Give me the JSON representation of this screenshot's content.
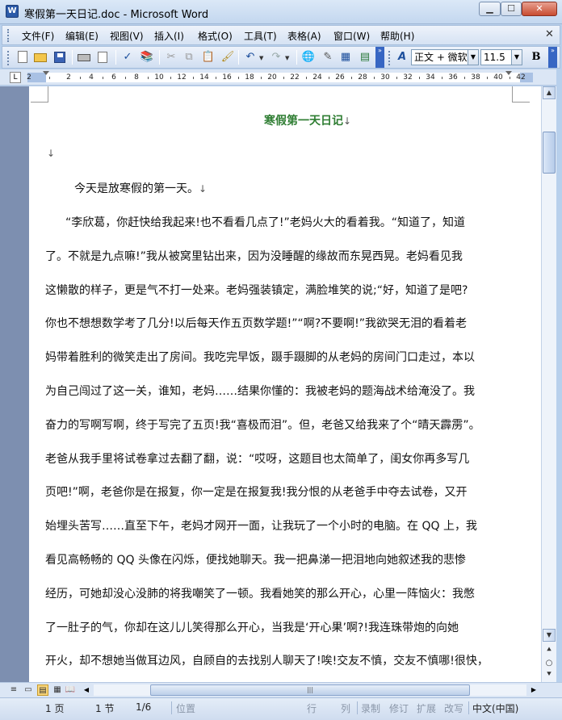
{
  "window": {
    "title": "寒假第一天日记.doc - Microsoft Word",
    "icon": "word-doc-icon",
    "minimize_glyph": "▁",
    "maximize_glyph": "☐",
    "close_glyph": "✕"
  },
  "menu": {
    "items": [
      "文件(F)",
      "编辑(E)",
      "视图(V)",
      "插入(I)",
      "格式(O)",
      "工具(T)",
      "表格(A)",
      "窗口(W)",
      "帮助(H)"
    ],
    "close_glyph": "✕"
  },
  "toolbar": {
    "icons": [
      "new-doc-icon",
      "open-folder-icon",
      "save-icon",
      "print-icon",
      "print-preview-icon",
      "spelling-icon",
      "research-icon",
      "cut-icon",
      "copy-icon",
      "paste-icon",
      "format-painter-icon",
      "undo-icon",
      "redo-icon",
      "hyperlink-icon",
      "tables-borders-icon",
      "insert-table-icon",
      "insert-excel-icon"
    ],
    "style_label": "正文 + 微软",
    "font_size": "11.5",
    "bold_label": "B",
    "styles_glyph": "A"
  },
  "ruler": {
    "numbers": [
      "2",
      "2",
      "4",
      "6",
      "8",
      "10",
      "12",
      "14",
      "16",
      "18",
      "20",
      "22",
      "24",
      "26",
      "28",
      "30",
      "32",
      "34",
      "36",
      "38",
      "40",
      "42"
    ],
    "tab_selector": "L"
  },
  "document": {
    "title": "寒假第一天日记",
    "para_mark": "↓",
    "first_paragraph": "今天是放寒假的第一天。",
    "body_lines": [
      "“李欣葛，你赶快给我起来!也不看看几点了!”老妈火大的看着我。“知道了，知道",
      "了。不就是九点嘛!”我从被窝里钻出来，因为没睡醒的缘故而东晃西晃。老妈看见我",
      "这懒散的样子，更是气不打一处来。老妈强装镇定，满脸堆笑的说;“好，知道了是吧?",
      "你也不想想数学考了几分!以后每天作五页数学题!”“啊?不要啊!”我欲哭无泪的看着老",
      "妈带着胜利的微笑走出了房间。我吃完早饭，蹑手蹑脚的从老妈的房间门口走过，本以",
      "为自己闯过了这一关，谁知，老妈……结果你懂的：我被老妈的题海战术给淹没了。我",
      "奋力的写啊写啊，终于写完了五页!我“喜极而泪”。但，老爸又给我来了个“晴天霹雳”。",
      "老爸从我手里将试卷拿过去翻了翻，说：“哎呀，这题目也太简单了，闺女你再多写几",
      "页吧!”啊，老爸你是在报复，你一定是在报复我!我分恨的从老爸手中夺去试卷，又开",
      "始埋头苦写……直至下午，老妈才网开一面，让我玩了一个小时的电脑。在 QQ 上，我",
      "看见高畅畅的 QQ 头像在闪烁，便找她聊天。我一把鼻涕一把泪地向她叙述我的悲惨",
      "经历，可她却没心没肺的将我嘲笑了一顿。我看她笑的那么开心，心里一阵恼火：我憋",
      "了一肚子的气，你却在这儿儿笑得那么开心，当我是‘开心果’啊?!我连珠带炮的向她",
      "开火，却不想她当做耳边风，自顾自的去找别人聊天了!唉!交友不慎，交友不慎哪!很快，"
    ],
    "title_color": "#2e7d32"
  },
  "scrollbars": {
    "up_glyph": "▲",
    "down_glyph": "▼",
    "prev_page_glyph": "⯅",
    "select_browse_glyph": "○",
    "next_page_glyph": "⯆",
    "left_glyph": "◀",
    "right_glyph": "▶",
    "thumb_grip": "|||"
  },
  "view_buttons": [
    "≡",
    "▭",
    "▤",
    "▦",
    "📖"
  ],
  "statusbar": {
    "page": "1 页",
    "section": "1 节",
    "page_of": "1/6",
    "position": "位置",
    "line": "行",
    "column": "列",
    "record": "录制",
    "revise": "修订",
    "extend": "扩展",
    "overtype": "改写",
    "language": "中文(中国)"
  },
  "colors": {
    "title_green": "#2e7d32",
    "chrome_blue": "#b8d0ec",
    "doc_background": "#7d8fb0"
  }
}
